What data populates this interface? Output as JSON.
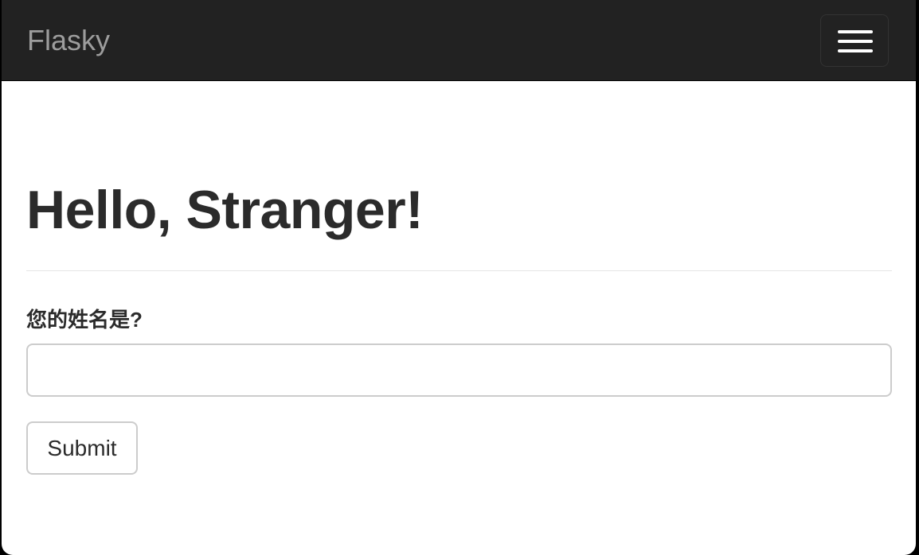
{
  "navbar": {
    "brand": "Flasky",
    "toggle_icon": "hamburger-menu-icon",
    "background": "#222222",
    "brand_color": "#9d9d9d"
  },
  "main": {
    "heading": "Hello, Stranger!",
    "form": {
      "name_label": "您的姓名是?",
      "name_value": "",
      "name_placeholder": "",
      "submit_label": "Submit"
    }
  }
}
